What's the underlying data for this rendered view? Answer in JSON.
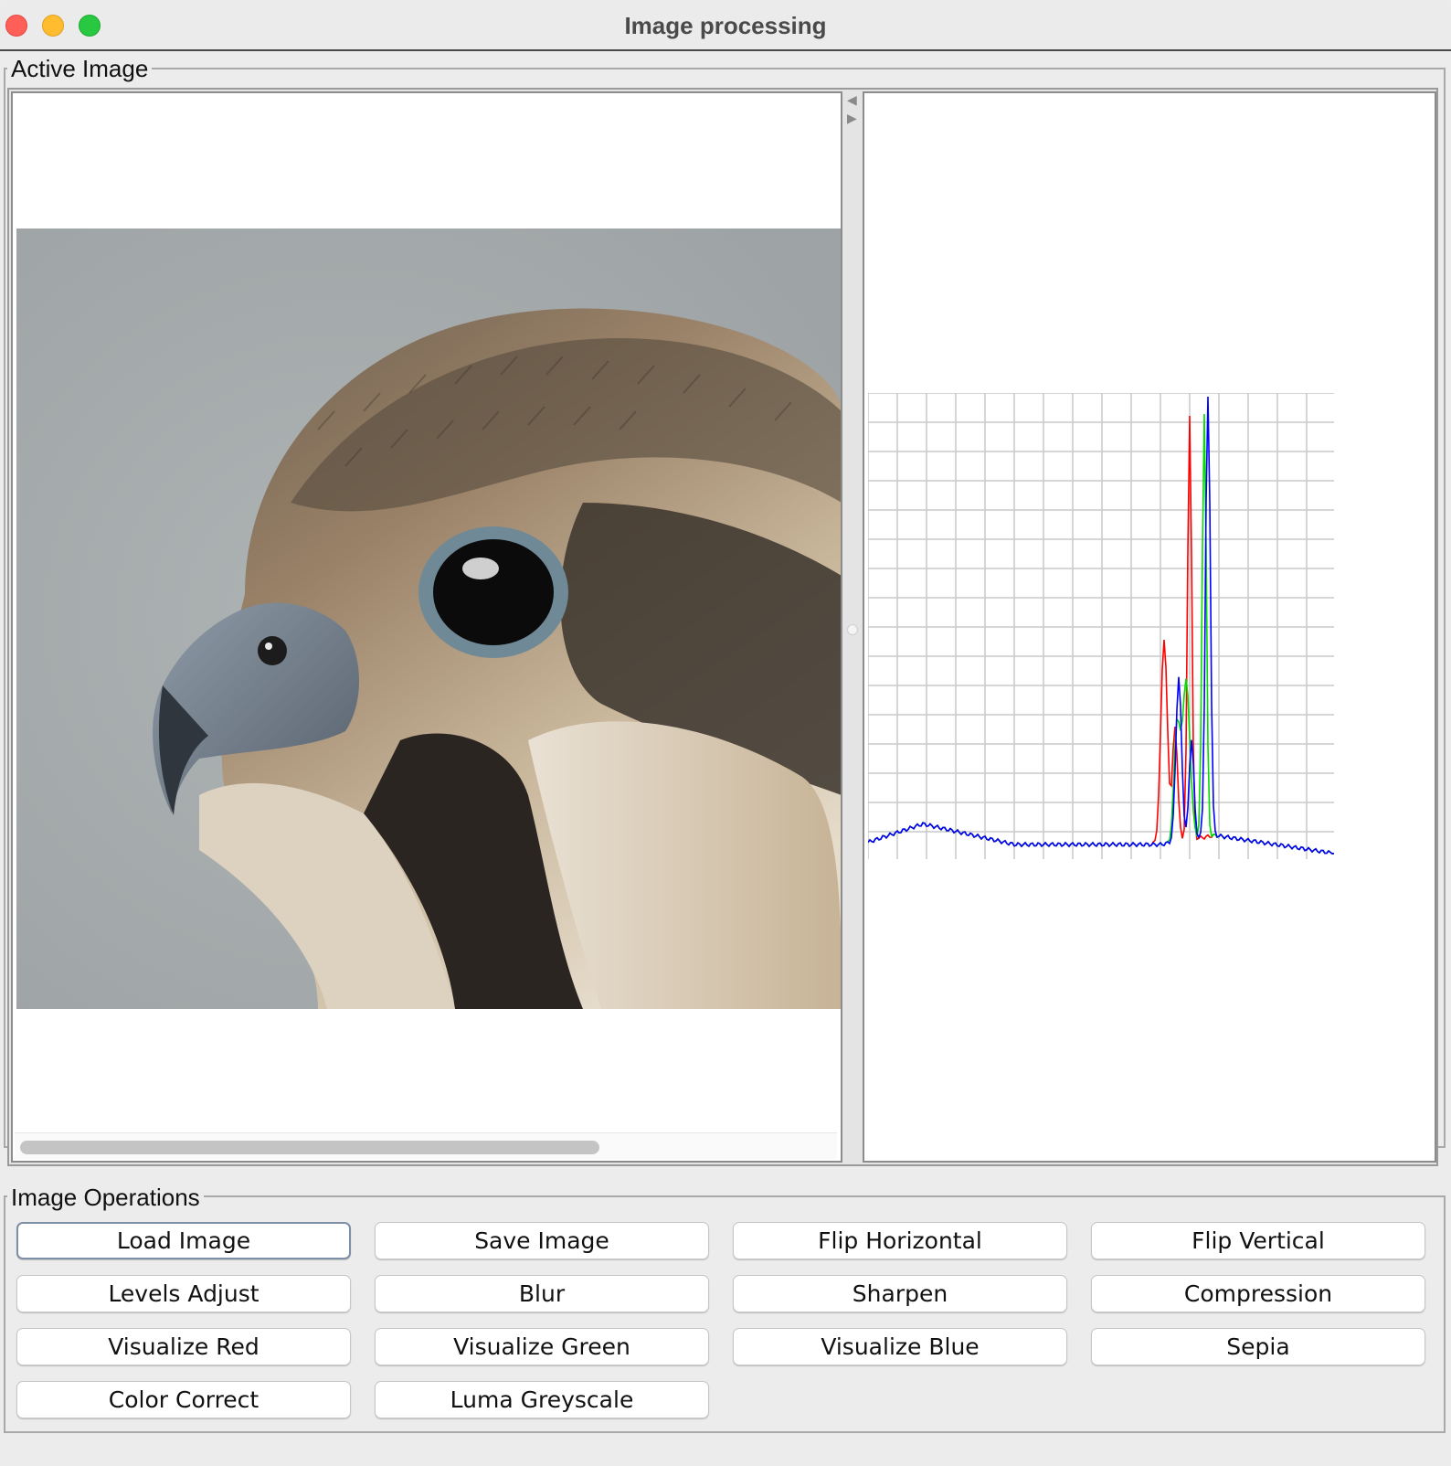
{
  "window": {
    "title": "Image processing"
  },
  "active_image": {
    "group_label": "Active Image",
    "image_subject": "peregrine falcon head photo",
    "histogram": {
      "series_colors": {
        "red": "#ff0000",
        "green": "#00dd00",
        "blue": "#0000ff"
      },
      "grid": true
    }
  },
  "operations": {
    "group_label": "Image Operations",
    "buttons": [
      {
        "label": "Load Image",
        "focused": true
      },
      {
        "label": "Save Image"
      },
      {
        "label": "Flip Horizontal"
      },
      {
        "label": "Flip Vertical"
      },
      {
        "label": "Levels Adjust"
      },
      {
        "label": "Blur"
      },
      {
        "label": "Sharpen"
      },
      {
        "label": "Compression"
      },
      {
        "label": "Visualize Red"
      },
      {
        "label": "Visualize Green"
      },
      {
        "label": "Visualize Blue"
      },
      {
        "label": "Sepia"
      },
      {
        "label": "Color Correct"
      },
      {
        "label": "Luma Greyscale"
      }
    ]
  }
}
